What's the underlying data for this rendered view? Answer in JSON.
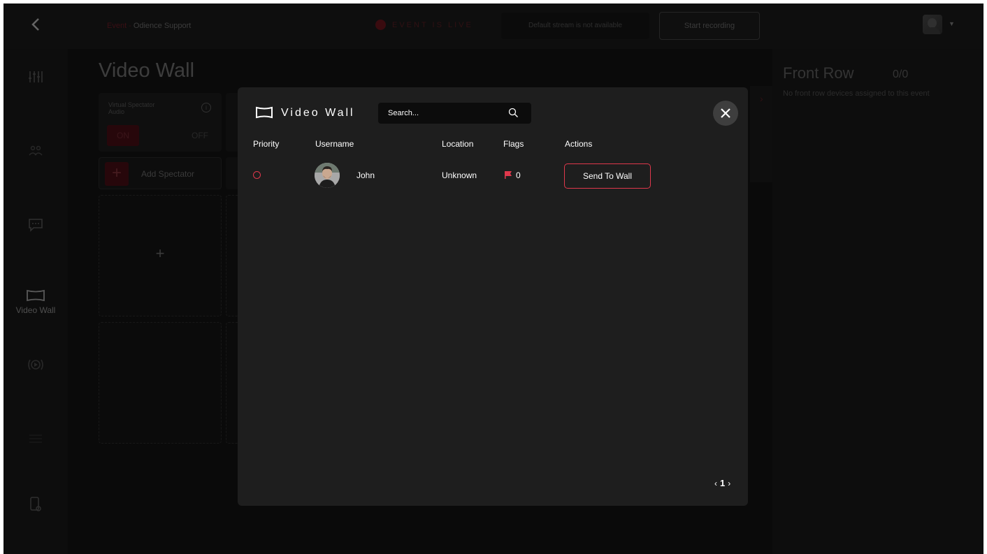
{
  "topbar": {
    "back_icon": "chevron-left-icon",
    "breadcrumb_event": "Event",
    "breadcrumb_separator": "-",
    "breadcrumb_current": "Odience Support",
    "live_status": "EVENT IS LIVE",
    "stream_status": "Default stream is not available",
    "start_recording": "Start recording",
    "avatar_icon": "user-avatar",
    "avatar_caret_icon": "caret-down-icon"
  },
  "leftnav": {
    "items": [
      {
        "icon": "sliders-icon",
        "label": ""
      },
      {
        "icon": "users-icon",
        "label": ""
      },
      {
        "icon": "chat-icon",
        "label": ""
      },
      {
        "icon": "video-wall-icon",
        "label": "Video Wall",
        "active": true
      },
      {
        "icon": "broadcast-play-icon",
        "label": ""
      },
      {
        "icon": "list-icon",
        "label": ""
      },
      {
        "icon": "device-icon",
        "label": ""
      }
    ]
  },
  "page": {
    "title": "Video Wall",
    "audio_card": {
      "label": "Virtual Spectator Audio",
      "on_label": "ON",
      "off_label": "OFF"
    },
    "add_spectator_label": "Add Spectator",
    "slot_plus": "+"
  },
  "right_panel": {
    "title": "Front Row",
    "count": "0/0",
    "empty_text": "No front row devices assigned to this event"
  },
  "modal": {
    "title": "Video Wall",
    "title_icon": "video-wall-icon",
    "search_placeholder": "Search...",
    "close_icon": "close-icon",
    "columns": [
      "Priority",
      "Username",
      "Location",
      "Flags",
      "Actions"
    ],
    "rows": [
      {
        "priority_icon": "priority-ring-icon",
        "username": "John",
        "location": "Unknown",
        "flag_icon": "flag-icon",
        "flags": "0",
        "action_label": "Send To Wall"
      }
    ],
    "pagination": {
      "prev": "‹",
      "page": "1",
      "next": "›"
    }
  },
  "colors": {
    "accent": "#e0384c",
    "modal_bg": "#1e1e1e",
    "app_bg": "#101010"
  }
}
